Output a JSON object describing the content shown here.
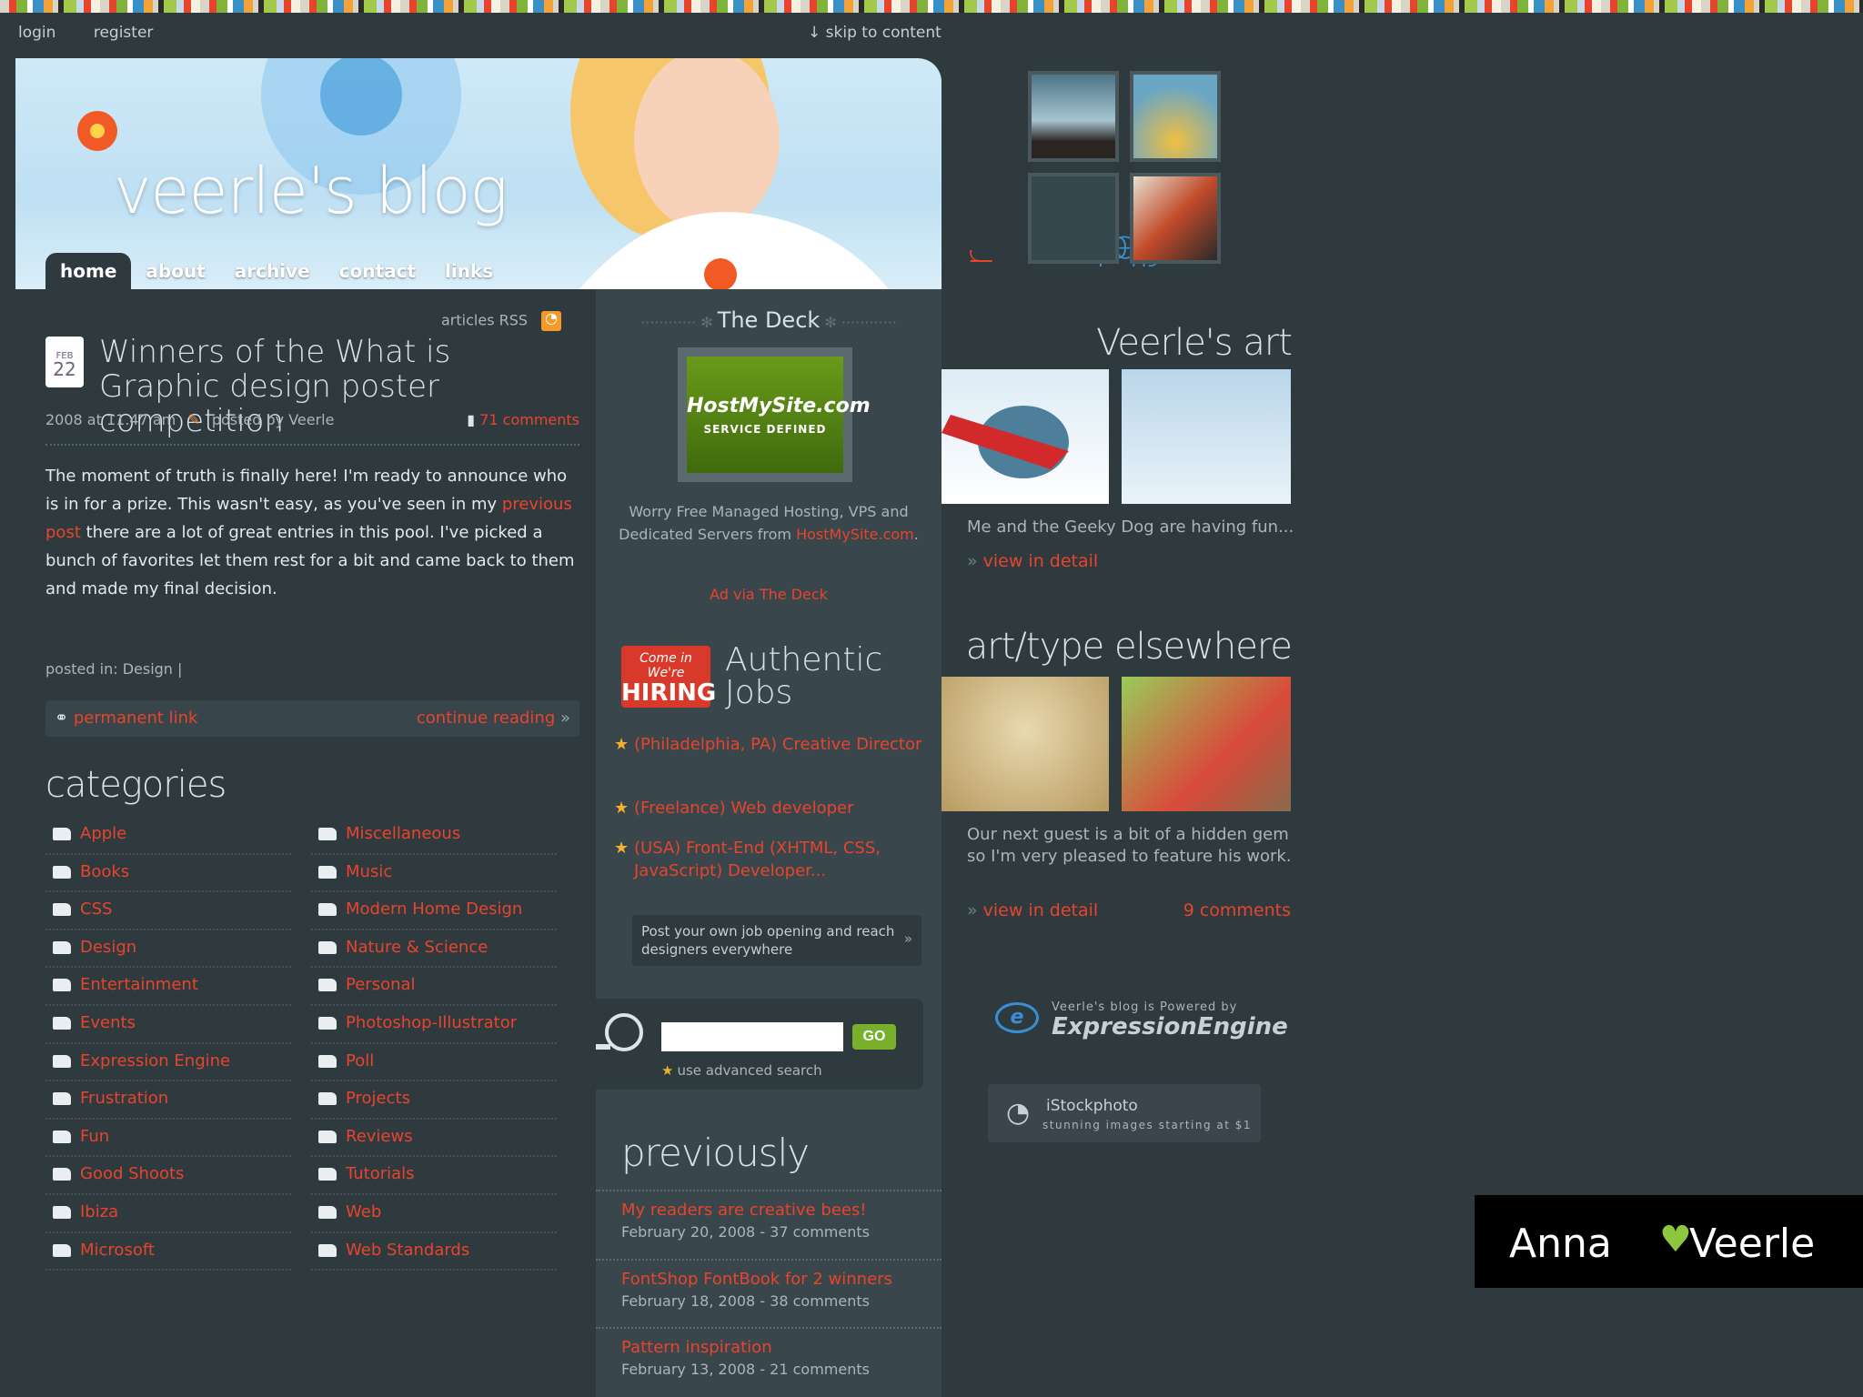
{
  "top_nav": {
    "login": "login",
    "register": "register",
    "skip": "skip to content"
  },
  "header": {
    "blog_title": "veerle's blog",
    "tabs": [
      "home",
      "about",
      "archive",
      "contact",
      "links"
    ],
    "active_tab": "home"
  },
  "post": {
    "articles_rss": "articles RSS",
    "date_month": "FEB",
    "date_day": "22",
    "title": "Winners of the What is Graphic design poster competition",
    "time": "2008 at 11.47 am",
    "author": "posted by Veerle",
    "comments": "71 comments",
    "body_1": "The moment of truth is finally here! I'm ready to announce who is in for a prize. This wasn't easy, as you've seen in my ",
    "body_link": "previous post",
    "body_2": " there are a lot of great entries in this pool. I've picked a bunch of favorites let them rest for a bit and came back to them and made my final decision.",
    "posted_in": "posted in: Design |",
    "permanent_link": "permanent link",
    "continue_reading": "continue reading"
  },
  "categories": {
    "heading": "categories",
    "left": [
      "Apple",
      "Books",
      "CSS",
      "Design",
      "Entertainment",
      "Events",
      "Expression Engine",
      "Frustration",
      "Fun",
      "Good Shoots",
      "Ibiza",
      "Microsoft"
    ],
    "right": [
      "Miscellaneous",
      "Music",
      "Modern Home Design",
      "Nature & Science",
      "Personal",
      "Photoshop-Illustrator",
      "Poll",
      "Projects",
      "Reviews",
      "Tutorials",
      "Web",
      "Web Standards"
    ]
  },
  "deck": {
    "title": "The Deck",
    "ad_brand": "HostMySite.com",
    "ad_tag": "SERVICE DEFINED",
    "text": "Worry Free Managed Hosting, VPS and Dedicated Servers from",
    "text_link": "HostMySite.com",
    "via": "Ad via The Deck"
  },
  "jobs": {
    "logo_line1": "Come in We're",
    "logo_line2": "HIRING",
    "title": "Authentic Jobs",
    "items": [
      "(Philadelphia, PA) Creative Director",
      "(Freelance) Web developer",
      "(USA) Front-End (XHTML, CSS, JavaScript) Developer..."
    ],
    "post_job": "Post your own job opening and reach designers everywhere"
  },
  "search": {
    "placeholder": "",
    "go": "GO",
    "advanced": "use advanced search"
  },
  "previously": {
    "heading": "previously",
    "items": [
      {
        "title": "My readers are creative bees!",
        "meta": "February 20, 2008 - 37 comments"
      },
      {
        "title": "FontShop FontBook for 2 winners",
        "meta": "February 18, 2008 - 38 comments"
      },
      {
        "title": "Pattern inspiration",
        "meta": "February 13, 2008 - 21 comments"
      }
    ]
  },
  "flickr": {
    "label_a": "flick",
    "label_b": "r",
    "label_c": "ness"
  },
  "art": {
    "heading": "Veerle's art",
    "caption": "Me and the Geeky Dog are having fun...",
    "view": "view in detail"
  },
  "elsewhere": {
    "heading": "art/type elsewhere",
    "caption": "Our next guest is a bit of a hidden gem so I'm very pleased to feature his work.",
    "view": "view in detail",
    "comments": "9 comments"
  },
  "powered": {
    "small": "Veerle's blog is Powered by",
    "big": "ExpressionEngine",
    "icon": "e"
  },
  "istock": {
    "name": "iStockphoto",
    "tagline": "stunning images starting at $1"
  },
  "overlay": {
    "left": "Anna",
    "right": "Veerle",
    "heart": "♥"
  },
  "colors": {
    "accent": "#e8442c",
    "flickr_blue": "#3a8fd4",
    "go_green": "#78b02c",
    "background": "#2f3a3f"
  }
}
